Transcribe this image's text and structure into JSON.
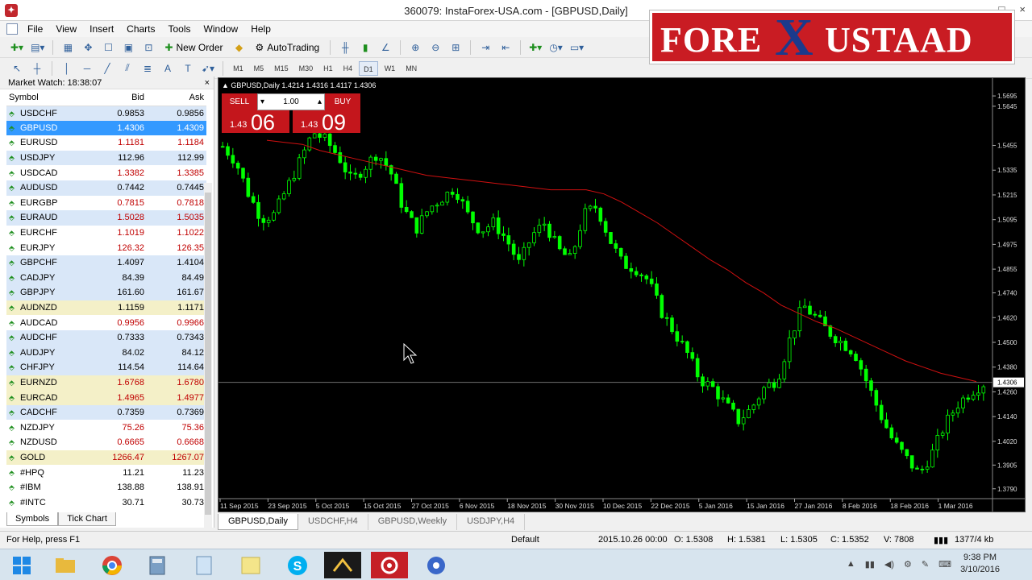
{
  "window": {
    "title": "360079: InstaForex-USA.com - [GBPUSD,Daily]",
    "controls": [
      "_",
      "□",
      "×"
    ]
  },
  "menu": [
    "File",
    "View",
    "Insert",
    "Charts",
    "Tools",
    "Window",
    "Help"
  ],
  "toolbar": {
    "new_order": "New Order",
    "auto_trading": "AutoTrading",
    "timeframes": [
      "M1",
      "M5",
      "M15",
      "M30",
      "H1",
      "H4",
      "D1",
      "W1",
      "MN"
    ],
    "active_timeframe": "D1"
  },
  "logo": {
    "part1": "FORE",
    "part2": "X",
    "part3": "USTAAD"
  },
  "market_watch": {
    "title": "Market Watch: 18:38:07",
    "close": "×",
    "columns": [
      "Symbol",
      "Bid",
      "Ask"
    ],
    "rows": [
      {
        "symbol": "USDCHF",
        "bid": "0.9853",
        "ask": "0.9856",
        "style": "bl"
      },
      {
        "symbol": "GBPUSD",
        "bid": "1.4306",
        "ask": "1.4309",
        "style": "sel"
      },
      {
        "symbol": "EURUSD",
        "bid": "1.1181",
        "ask": "1.1184",
        "style": "wh",
        "red": true
      },
      {
        "symbol": "USDJPY",
        "bid": "112.96",
        "ask": "112.99",
        "style": "bl"
      },
      {
        "symbol": "USDCAD",
        "bid": "1.3382",
        "ask": "1.3385",
        "style": "wh",
        "red": true
      },
      {
        "symbol": "AUDUSD",
        "bid": "0.7442",
        "ask": "0.7445",
        "style": "bl"
      },
      {
        "symbol": "EURGBP",
        "bid": "0.7815",
        "ask": "0.7818",
        "style": "wh",
        "red": true
      },
      {
        "symbol": "EURAUD",
        "bid": "1.5028",
        "ask": "1.5035",
        "style": "bl",
        "red": true
      },
      {
        "symbol": "EURCHF",
        "bid": "1.1019",
        "ask": "1.1022",
        "style": "wh",
        "red": true
      },
      {
        "symbol": "EURJPY",
        "bid": "126.32",
        "ask": "126.35",
        "style": "wh",
        "red": true
      },
      {
        "symbol": "GBPCHF",
        "bid": "1.4097",
        "ask": "1.4104",
        "style": "bl"
      },
      {
        "symbol": "CADJPY",
        "bid": "84.39",
        "ask": "84.49",
        "style": "bl"
      },
      {
        "symbol": "GBPJPY",
        "bid": "161.60",
        "ask": "161.67",
        "style": "bl"
      },
      {
        "symbol": "AUDNZD",
        "bid": "1.1159",
        "ask": "1.1171",
        "style": "yl"
      },
      {
        "symbol": "AUDCAD",
        "bid": "0.9956",
        "ask": "0.9966",
        "style": "wh",
        "red": true
      },
      {
        "symbol": "AUDCHF",
        "bid": "0.7333",
        "ask": "0.7343",
        "style": "bl"
      },
      {
        "symbol": "AUDJPY",
        "bid": "84.02",
        "ask": "84.12",
        "style": "bl"
      },
      {
        "symbol": "CHFJPY",
        "bid": "114.54",
        "ask": "114.64",
        "style": "bl"
      },
      {
        "symbol": "EURNZD",
        "bid": "1.6768",
        "ask": "1.6780",
        "style": "yl",
        "red": true
      },
      {
        "symbol": "EURCAD",
        "bid": "1.4965",
        "ask": "1.4977",
        "style": "yl",
        "red": true
      },
      {
        "symbol": "CADCHF",
        "bid": "0.7359",
        "ask": "0.7369",
        "style": "bl"
      },
      {
        "symbol": "NZDJPY",
        "bid": "75.26",
        "ask": "75.36",
        "style": "wh",
        "red": true
      },
      {
        "symbol": "NZDUSD",
        "bid": "0.6665",
        "ask": "0.6668",
        "style": "wh",
        "red": true
      },
      {
        "symbol": "GOLD",
        "bid": "1266.47",
        "ask": "1267.07",
        "style": "yl",
        "red": true
      },
      {
        "symbol": "#HPQ",
        "bid": "11.21",
        "ask": "11.23",
        "style": "wh"
      },
      {
        "symbol": "#IBM",
        "bid": "138.88",
        "ask": "138.91",
        "style": "wh"
      },
      {
        "symbol": "#INTC",
        "bid": "30.71",
        "ask": "30.73",
        "style": "wh"
      }
    ],
    "tabs": [
      "Symbols",
      "Tick Chart"
    ]
  },
  "chart": {
    "header": "GBPUSD,Daily  1.4214 1.4316 1.4117 1.4306",
    "trade_panel": {
      "sell_label": "SELL",
      "buy_label": "BUY",
      "lot": "1.00",
      "sell_small": "1.43",
      "sell_big": "06",
      "buy_small": "1.43",
      "buy_big": "09"
    },
    "colors": {
      "background": "#000000",
      "candles": "#00ff00",
      "ma": "#d01010",
      "price_line": "#a0a0a0"
    }
  },
  "chart_data": {
    "type": "candlestick",
    "symbol": "GBPUSD",
    "timeframe": "Daily",
    "y_ticks": [
      "1.5695",
      "1.5645",
      "1.5455",
      "1.5335",
      "1.5215",
      "1.5095",
      "1.4975",
      "1.4855",
      "1.4740",
      "1.4620",
      "1.4500",
      "1.4380",
      "1.4306",
      "1.4260",
      "1.4140",
      "1.4020",
      "1.3905",
      "1.3790"
    ],
    "x_ticks": [
      "11 Sep 2015",
      "23 Sep 2015",
      "5 Oct 2015",
      "15 Oct 2015",
      "27 Oct 2015",
      "6 Nov 2015",
      "18 Nov 2015",
      "30 Nov 2015",
      "10 Dec 2015",
      "22 Dec 2015",
      "5 Jan 2016",
      "15 Jan 2016",
      "27 Jan 2016",
      "8 Feb 2016",
      "18 Feb 2016",
      "1 Mar 2016"
    ],
    "current_price": 1.4306,
    "ylim": [
      1.375,
      1.575
    ],
    "close_path": [
      1.545,
      1.538,
      1.522,
      1.51,
      1.512,
      1.525,
      1.538,
      1.552,
      1.548,
      1.54,
      1.528,
      1.535,
      1.542,
      1.533,
      1.515,
      1.505,
      1.515,
      1.52,
      1.525,
      1.512,
      1.504,
      1.508,
      1.5,
      1.488,
      1.502,
      1.508,
      1.495,
      1.49,
      1.512,
      1.516,
      1.5,
      1.488,
      1.486,
      1.48,
      1.465,
      1.455,
      1.445,
      1.432,
      1.428,
      1.42,
      1.412,
      1.418,
      1.428,
      1.432,
      1.452,
      1.468,
      1.462,
      1.455,
      1.45,
      1.445,
      1.43,
      1.415,
      1.402,
      1.394,
      1.386,
      1.396,
      1.41,
      1.42,
      1.426,
      1.43
    ],
    "ma_path": [
      1.548,
      1.547,
      1.546,
      1.543,
      1.541,
      1.539,
      1.537,
      1.535,
      1.533,
      1.531,
      1.53,
      1.529,
      1.528,
      1.527,
      1.526,
      1.525,
      1.524,
      1.524,
      1.524,
      1.522,
      1.518,
      1.513,
      1.508,
      1.502,
      1.496,
      1.49,
      1.485,
      1.479,
      1.474,
      1.468,
      1.464,
      1.46,
      1.457,
      1.453,
      1.449,
      1.445,
      1.441,
      1.438,
      1.435,
      1.433,
      1.431
    ]
  },
  "chart_tabs": [
    "GBPUSD,Daily",
    "USDCHF,H4",
    "GBPUSD,Weekly",
    "USDJPY,H4"
  ],
  "status": {
    "help": "For Help, press F1",
    "profile": "Default",
    "datetime": "2015.10.26 00:00",
    "open": "O: 1.5308",
    "high": "H: 1.5381",
    "low": "L: 1.5305",
    "close": "C: 1.5352",
    "volume": "V: 7808",
    "traffic": "1377/4 kb"
  },
  "taskbar": {
    "time": "9:38 PM",
    "date": "3/10/2016"
  }
}
